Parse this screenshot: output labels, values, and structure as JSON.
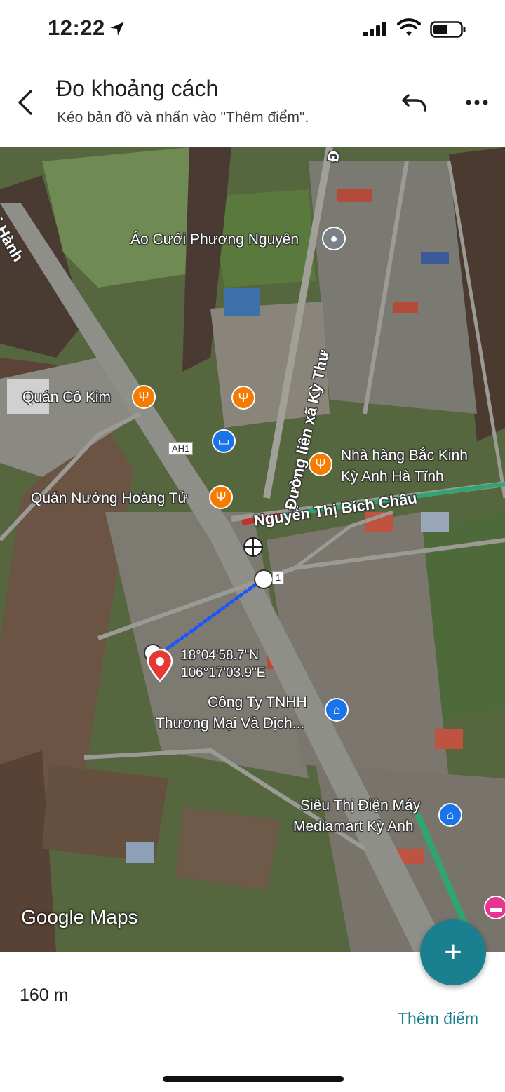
{
  "status_bar": {
    "time": "12:22"
  },
  "header": {
    "title": "Đo khoảng cách",
    "subtitle": "Kéo bản đồ và nhấn vào \"Thêm điểm\"."
  },
  "map": {
    "labels": {
      "ao_cuoi": "Áo Cưới Phương Nguyên",
      "quan_co_kim": "Quán Cô Kim",
      "quan_nuong": "Quán Nướng Hoàng Tử",
      "nha_hang_line1": "Nhà hàng Bắc Kinh",
      "nha_hang_line2": "Kỳ Anh Hà Tĩnh",
      "cong_ty_line1": "Công Ty TNHH",
      "cong_ty_line2": "Thương Mại Và Dịch...",
      "sieu_thi_line1": "Siêu Thị Điện Máy",
      "sieu_thi_line2": "Mediamart Kỳ Anh",
      "road_nguyen": "Nguyễn Thị Bích Châu",
      "road_duong_lien": "Đường liên xã Kỳ Thư",
      "road_hanh": "i Hành",
      "road_top": "Đ",
      "road_sign": "AH1",
      "road_sign_2": "1"
    },
    "coords": {
      "lat": "18°04'58.7\"N",
      "lng": "106°17'03.9\"E"
    },
    "attribution": "Google Maps"
  },
  "bottom": {
    "distance": "160 m",
    "add_point_label": "Thêm điểm"
  },
  "icons": {
    "back": "chevron-left-icon",
    "undo": "undo-icon",
    "more": "more-horiz-icon",
    "fab": "plus-icon"
  },
  "colors": {
    "accent": "#1a7f8e",
    "poi_food": "#f57c00",
    "poi_shop": "#1a73e8",
    "pin_red": "#e53935",
    "measure_line": "#1a56ff"
  }
}
